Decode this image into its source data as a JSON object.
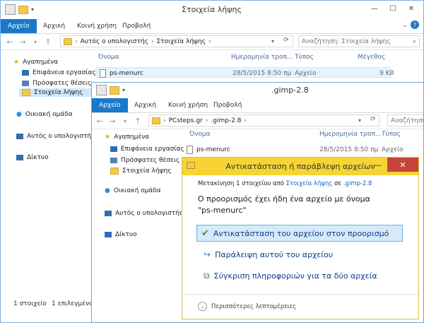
{
  "back_window": {
    "title": "Στοιχεία λήψης",
    "ribbon": {
      "file": "Αρχείο",
      "tabs": [
        "Αρχική",
        "Κοινή χρήση",
        "Προβολή"
      ]
    },
    "address": {
      "parts": [
        "Αυτός ο υπολογιστής",
        "Στοιχεία λήψης"
      ]
    },
    "search_placeholder": "Αναζήτηση: Στοιχεία λήψης",
    "nav": {
      "favorites": "Αγαπημένα",
      "desktop": "Επιφάνεια εργασίας",
      "recent": "Πρόσφατες θέσεις",
      "downloads": "Στοιχεία λήψης",
      "homegroup": "Οικιακή ομάδα",
      "thispc": "Αυτός ο υπολογιστής",
      "network": "Δίκτυο"
    },
    "columns": {
      "name": "Όνομα",
      "date": "Ημερομηνία τροπ...",
      "type": "Τύπος",
      "size": "Μέγεθος"
    },
    "file": {
      "name": "ps-menurc",
      "date": "28/5/2015 8:50 πμ",
      "type": "Αρχείο",
      "size": "9 KB"
    },
    "status": {
      "count": "1 στοιχείο",
      "selected": "1 επιλεγμένο σ"
    }
  },
  "front_window": {
    "title": ".gimp-2.8",
    "ribbon": {
      "file": "Αρχείο",
      "tabs": [
        "Αρχική",
        "Κοινή χρήση",
        "Προβολή"
      ]
    },
    "address": {
      "parts": [
        "PCsteps.gr",
        ".gimp-2.8"
      ]
    },
    "search_placeholder": "Αναζήτηση",
    "nav": {
      "favorites": "Αγαπημένα",
      "desktop": "Επιφάνεια εργασίας",
      "recent": "Πρόσφατες θέσεις",
      "downloads": "Στοιχεία λήψης",
      "homegroup": "Οικιακή ομάδα",
      "thispc": "Αυτός ο υπολογιστής",
      "network": "Δίκτυο"
    },
    "columns": {
      "name": "Όνομα",
      "date": "Ημερομηνία τροπ...",
      "type": "Τύπος"
    },
    "file": {
      "name": "ps-menurc",
      "date": "28/5/2015 8:50 πμ",
      "type": "Αρχείο"
    }
  },
  "dialog": {
    "title": "Αντικατάσταση ή παράβλεψη αρχείων",
    "moving_prefix": "Μετακίνηση 1 στοιχείου από",
    "moving_from": "Στοιχεία λήψης",
    "moving_to_word": "σε",
    "moving_to": ".gimp-2.8",
    "message_line1": "Ο προορισμός έχει ήδη ένα αρχείο με όνομα",
    "message_line2": "\"ps-menurc\"",
    "option_replace": "Αντικατάσταση του αρχείου στον προορισμό",
    "option_skip": "Παράλειψη αυτού του αρχείου",
    "option_compare": "Σύγκριση πληροφοριών για τα δύο αρχεία",
    "more_details": "Περισσότερες λεπτομέρειες"
  },
  "colors": {
    "ribbon_file": "#1979ca",
    "dialog_title": "#f6d433",
    "close_red": "#c7443b",
    "selection": "#d7eaf9"
  }
}
